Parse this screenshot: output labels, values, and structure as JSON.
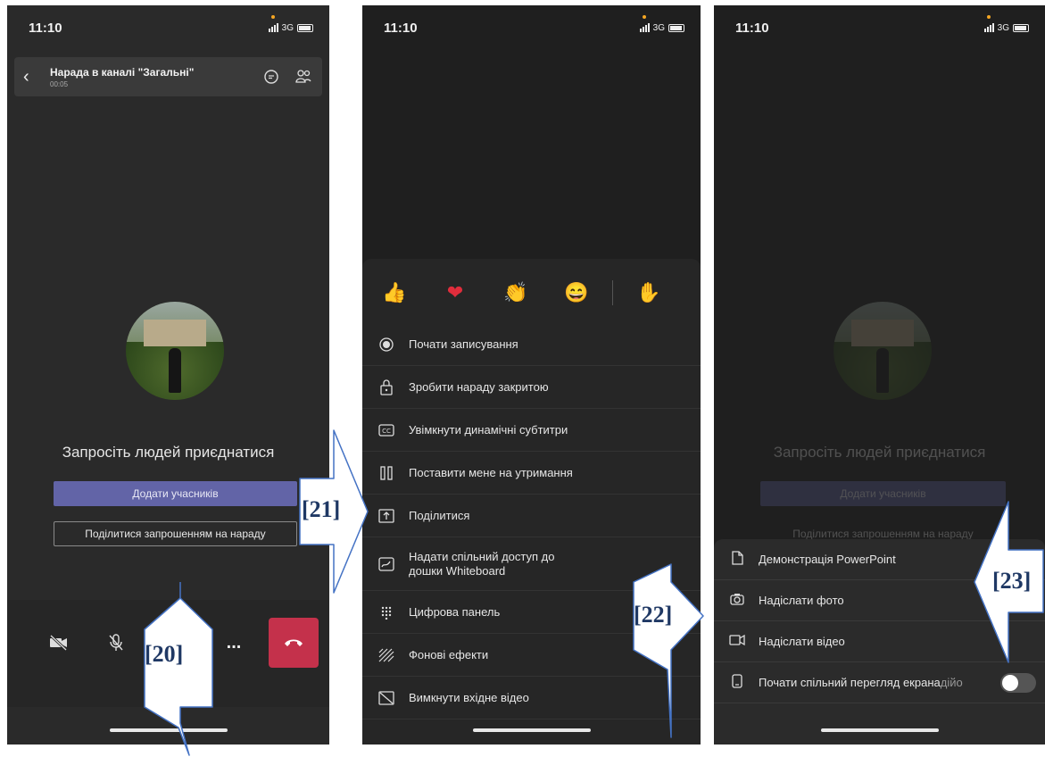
{
  "status": {
    "time": "11:10",
    "network": "3G"
  },
  "panel1": {
    "meeting_title": "Нарада в каналі \"Загальні\"",
    "duration": "00:05",
    "invite_heading": "Запросіть людей приєднатися",
    "add_participants": "Додати учасників",
    "share_invite": "Поділитися запрошенням на нараду",
    "more_label": "..."
  },
  "panel2": {
    "menu": [
      "Почати записування",
      "Зробити нараду закритою",
      "Увімкнути динамічні субтитри",
      "Поставити мене на утримання",
      "Поділитися",
      "Надати спільний доступ до дошки Whiteboard",
      "Цифрова панель",
      "Фонові ефекти",
      "Вимкнути вхідне відео"
    ]
  },
  "panel3": {
    "menu": [
      "Демонстрація PowerPoint",
      "Надіслати фото",
      "Надіслати відео",
      "Почати спільний перегляд екрана"
    ],
    "overlap_suffix": "дійо"
  },
  "callouts": [
    "[20]",
    "[21]",
    "[22]",
    "[23]"
  ],
  "colors": {
    "accent": "#6264a7",
    "hangup": "#c4314b",
    "callout_fill": "#ffffff",
    "callout_stroke": "#4472c4"
  }
}
